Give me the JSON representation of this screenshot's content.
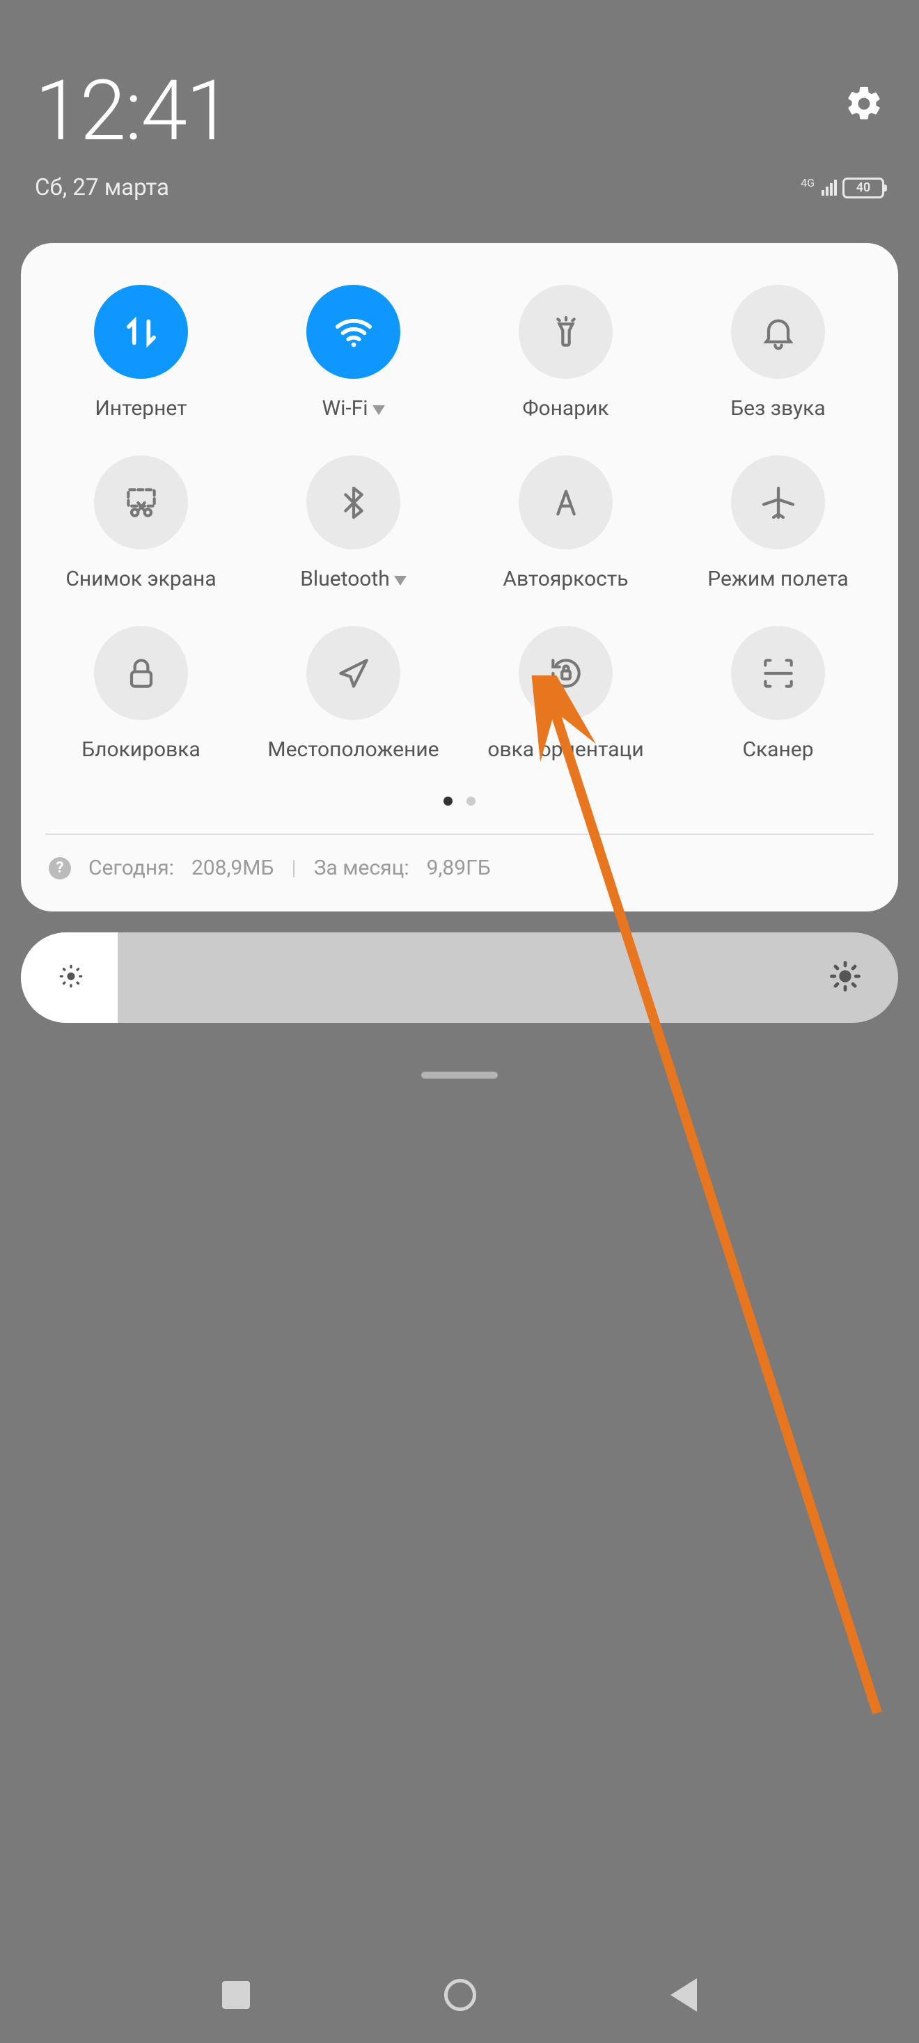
{
  "header": {
    "time": "12:41",
    "date": "Сб, 27 марта",
    "battery": "40",
    "network": "4G"
  },
  "tiles": [
    {
      "id": "internet",
      "label": "Интернет",
      "active": true
    },
    {
      "id": "wifi",
      "label": "Wi-Fi",
      "active": true,
      "expand": true
    },
    {
      "id": "flashlight",
      "label": "Фонарик",
      "active": false
    },
    {
      "id": "mute",
      "label": "Без звука",
      "active": false
    },
    {
      "id": "screenshot",
      "label": "Снимок экрана",
      "active": false
    },
    {
      "id": "bluetooth",
      "label": "Bluetooth",
      "active": false,
      "expand": true
    },
    {
      "id": "autobright",
      "label": "Автояркость",
      "active": false
    },
    {
      "id": "airplane",
      "label": "Режим полета",
      "active": false
    },
    {
      "id": "lock",
      "label": "Блокировка",
      "active": false
    },
    {
      "id": "location",
      "label": "Местоположение",
      "active": false
    },
    {
      "id": "rotation",
      "label": "овка ориентаци",
      "active": false
    },
    {
      "id": "scanner",
      "label": "Сканер",
      "active": false
    }
  ],
  "pager": {
    "pages": 2,
    "active": 0
  },
  "datausage": {
    "today_label": "Сегодня:",
    "today_value": "208,9МБ",
    "month_label": "За месяц:",
    "month_value": "9,89ГБ"
  },
  "annotation": {
    "arrow_color": "#e8761f"
  }
}
